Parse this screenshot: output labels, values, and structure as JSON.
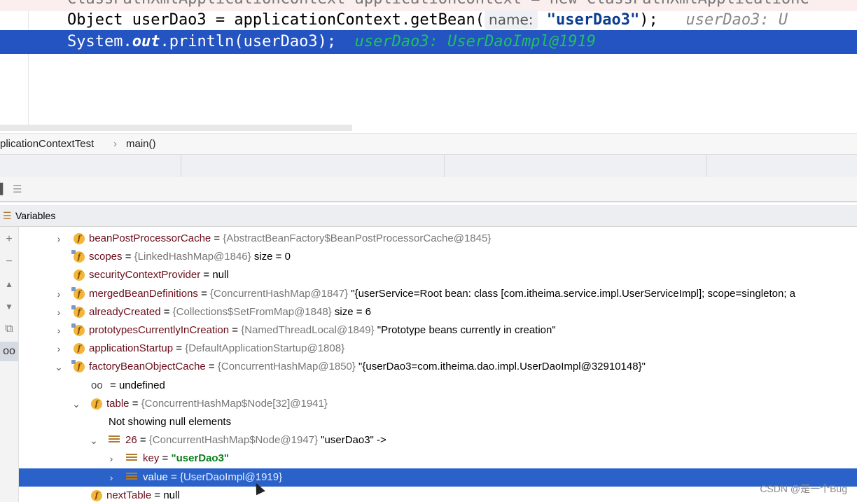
{
  "editor": {
    "line0_partial": "ClassPathXmlApplicationContext applicationContext = new ClassPathXmlApplicationC",
    "line1_prefix": "Object userDao3 = applicationContext.getBean(",
    "line1_hint": "name:",
    "line1_arg": "\"userDao3\"",
    "line1_suffix": ");",
    "line1_inline": "userDao3: U",
    "line2_code_a": "System.",
    "line2_code_b": "out",
    "line2_code_c": ".println(userDao3);",
    "line2_inline": "userDao3: UserDaoImpl@1919"
  },
  "breadcrumb": {
    "class": "plicationContextTest",
    "separator": "›",
    "method": "main()"
  },
  "variables_panel": {
    "title": "Variables"
  },
  "side_tools": [
    "+",
    "−",
    "▲",
    "▼",
    "⧉",
    "oo"
  ],
  "tree": [
    {
      "indent": 0,
      "chev": "›",
      "icon": "f",
      "name": "beanPostProcessorCache",
      "eq": " = ",
      "ref": "{AbstractBeanFactory$BeanPostProcessorCache@1845}",
      "extra": ""
    },
    {
      "indent": 0,
      "chev": "",
      "icon": "f-lock",
      "name": "scopes",
      "eq": " = ",
      "ref": "{LinkedHashMap@1846}",
      "extra": " size = 0"
    },
    {
      "indent": 0,
      "chev": "",
      "icon": "f",
      "name": "securityContextProvider",
      "eq": " = ",
      "ref": "",
      "extra": "null"
    },
    {
      "indent": 0,
      "chev": "›",
      "icon": "f-lock",
      "name": "mergedBeanDefinitions",
      "eq": " = ",
      "ref": "{ConcurrentHashMap@1847}",
      "extra": " \"{userService=Root bean: class [com.itheima.service.impl.UserServiceImpl]; scope=singleton; a"
    },
    {
      "indent": 0,
      "chev": "›",
      "icon": "f-lock",
      "name": "alreadyCreated",
      "eq": " = ",
      "ref": "{Collections$SetFromMap@1848}",
      "extra": " size = 6"
    },
    {
      "indent": 0,
      "chev": "›",
      "icon": "f-lock",
      "name": "prototypesCurrentlyInCreation",
      "eq": " = ",
      "ref": "{NamedThreadLocal@1849}",
      "extra": " \"Prototype beans currently in creation\""
    },
    {
      "indent": 0,
      "chev": "›",
      "icon": "f",
      "name": "applicationStartup",
      "eq": " = ",
      "ref": "{DefaultApplicationStartup@1808}",
      "extra": ""
    },
    {
      "indent": 0,
      "chev": "⌄",
      "icon": "f-lock",
      "name": "factoryBeanObjectCache",
      "eq": " = ",
      "ref": "{ConcurrentHashMap@1850}",
      "extra": " \"{userDao3=com.itheima.dao.impl.UserDaoImpl@32910148}\""
    },
    {
      "indent": 1,
      "chev": "",
      "icon": "infinity",
      "name": "",
      "eq": "= ",
      "ref": "",
      "extra": "undefined"
    },
    {
      "indent": 1,
      "chev": "⌄",
      "icon": "f",
      "name": "table",
      "eq": " = ",
      "ref": "{ConcurrentHashMap$Node[32]@1941}",
      "extra": ""
    },
    {
      "indent": 2,
      "chev": "",
      "icon": "none",
      "name": "",
      "eq": "",
      "ref": "",
      "extra": "Not showing null elements"
    },
    {
      "indent": 2,
      "chev": "⌄",
      "icon": "arr",
      "name": "26",
      "eq": " = ",
      "ref": "{ConcurrentHashMap$Node@1947}",
      "extra": " \"userDao3\" ->"
    },
    {
      "indent": 3,
      "chev": "›",
      "icon": "arr",
      "name": "key",
      "eq": " = ",
      "ref": "",
      "extra": "\"userDao3\"",
      "strval": true
    },
    {
      "indent": 3,
      "chev": "›",
      "icon": "arr",
      "name": "value",
      "eq": " = ",
      "ref": "{UserDaoImpl@1919}",
      "extra": "",
      "selected": true
    },
    {
      "indent": 1,
      "chev": "",
      "icon": "f",
      "name": "nextTable",
      "eq": " = ",
      "ref": "",
      "extra": "null"
    }
  ],
  "watermark": "CSDN @是一个Bug"
}
